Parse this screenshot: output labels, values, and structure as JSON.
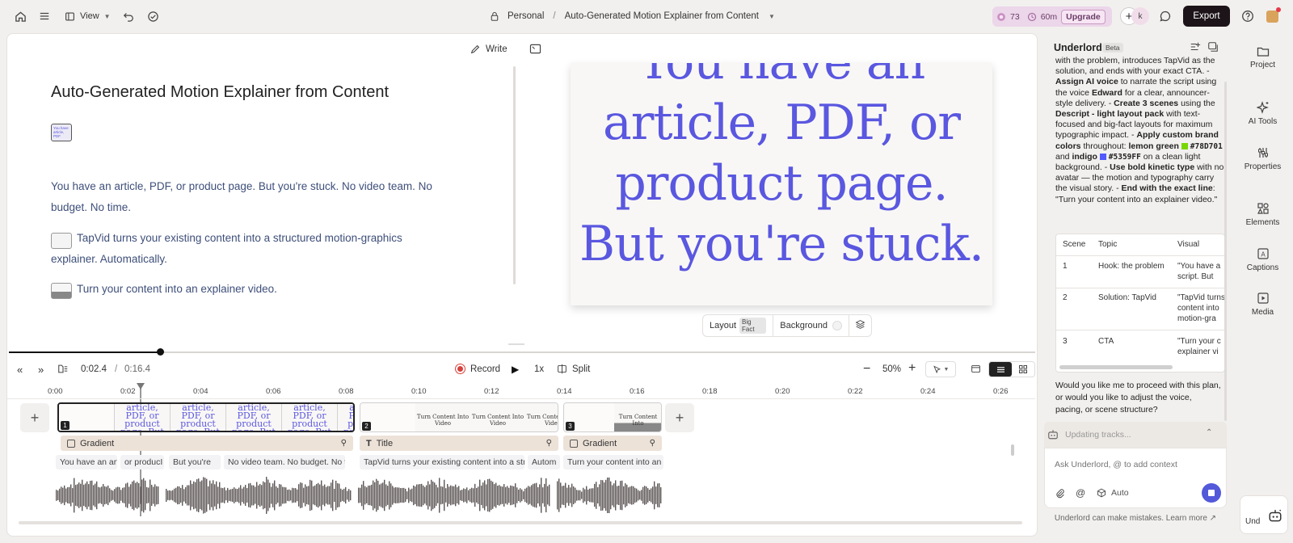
{
  "topbar": {
    "view_label": "View",
    "workspace": "Personal",
    "separator": "/",
    "project_title": "Auto-Generated Motion Explainer from Content",
    "credits": "73",
    "time": "60m",
    "upgrade_label": "Upgrade",
    "avatar_letter": "k",
    "export_label": "Export",
    "accent": "#1d1419"
  },
  "script": {
    "write_label": "Write",
    "title": "Auto-Generated Motion Explainer from Content",
    "paragraphs": [
      "You have an article, PDF, or product page. But you're stuck. No video team. No budget. No time.",
      "TapVid turns your existing content into a structured motion-graphics explainer. Automatically.",
      "Turn your content into an explainer video."
    ]
  },
  "preview": {
    "text_lines": [
      "You have an",
      "article, PDF, or",
      "product page.",
      "But you're stuck."
    ],
    "text_color": "#5a57e0",
    "layout_label": "Layout",
    "layout_badge": "Big Fact",
    "background_label": "Background"
  },
  "timeline": {
    "current_time": "0:02.4",
    "separator": "/",
    "total_time": "0:16.4",
    "record_label": "Record",
    "speed_label": "1x",
    "split_label": "Split",
    "zoom": "50%",
    "ruler": [
      "0:00",
      "0:02",
      "0:04",
      "0:06",
      "0:08",
      "0:10",
      "0:12",
      "0:14",
      "0:16",
      "0:18",
      "0:20",
      "0:22",
      "0:24",
      "0:26"
    ],
    "scene_numbers": [
      "1",
      "2",
      "3"
    ],
    "scene1_thumb": "article, PDF, or product page. But you're stuck",
    "scene2_thumb": "Turn Content Into Video",
    "scene3_thumb": "Turn Content Into",
    "track_labels": [
      "Gradient",
      "Title",
      "Gradient"
    ],
    "words": [
      "You have an arti",
      "or producI",
      "But you're",
      "No video team. No budget. No ti",
      "TapVid turns your existing content into a str",
      "Autom",
      "Turn your content into an e"
    ]
  },
  "assistant": {
    "title": "Underlord",
    "beta": "Beta",
    "body_intro": "with the problem, introduces TapVid as the solution, and ends with your exact CTA. -",
    "assign_voice": "Assign AI voice",
    "voice_text": "to narrate the script using the voice",
    "voice_name": "Edward",
    "voice_tail": "for a clear, announcer-style delivery. -",
    "create_scenes": "Create 3 scenes",
    "scenes_text": "using the",
    "layout_pack": "Descript - light layout pack",
    "layout_tail": "with text-focused and big-fact layouts for maximum typographic impact. -",
    "apply_colors": "Apply custom brand colors",
    "colors_text": "throughout:",
    "lemon": "lemon green",
    "lemon_hex": "#78D701",
    "and_text": "and",
    "indigo": "indigo",
    "indigo_hex": "#5359FF",
    "bg_text": "on a clean light background. -",
    "use_bold": "Use bold kinetic type",
    "bold_tail": "with no avatar — the motion and typography carry the visual story. -",
    "end_line": "End with the exact line",
    "end_tail": ": \"Turn your content into an explainer video.\"",
    "table_headers": [
      "Scene",
      "Topic",
      "Visual"
    ],
    "table_rows": [
      {
        "scene": "1",
        "topic": "Hook: the problem",
        "visual": "\"You have a script. But"
      },
      {
        "scene": "2",
        "topic": "Solution: TapVid",
        "visual": "\"TapVid turns content into motion-gra"
      },
      {
        "scene": "3",
        "topic": "CTA",
        "visual": "\"Turn your c explainer vi"
      }
    ],
    "question": "Would you like me to proceed with this plan, or would you like to adjust the voice, pacing, or scene structure?",
    "status": "Updating tracks...",
    "input_placeholder": "Ask Underlord, @ to add context",
    "auto_label": "Auto",
    "disclaimer": "Underlord can make mistakes. Learn more ↗"
  },
  "sidebar": {
    "items": [
      "Project",
      "AI Tools",
      "Properties",
      "Elements",
      "Captions",
      "Media"
    ],
    "bottom_label": "Und"
  }
}
